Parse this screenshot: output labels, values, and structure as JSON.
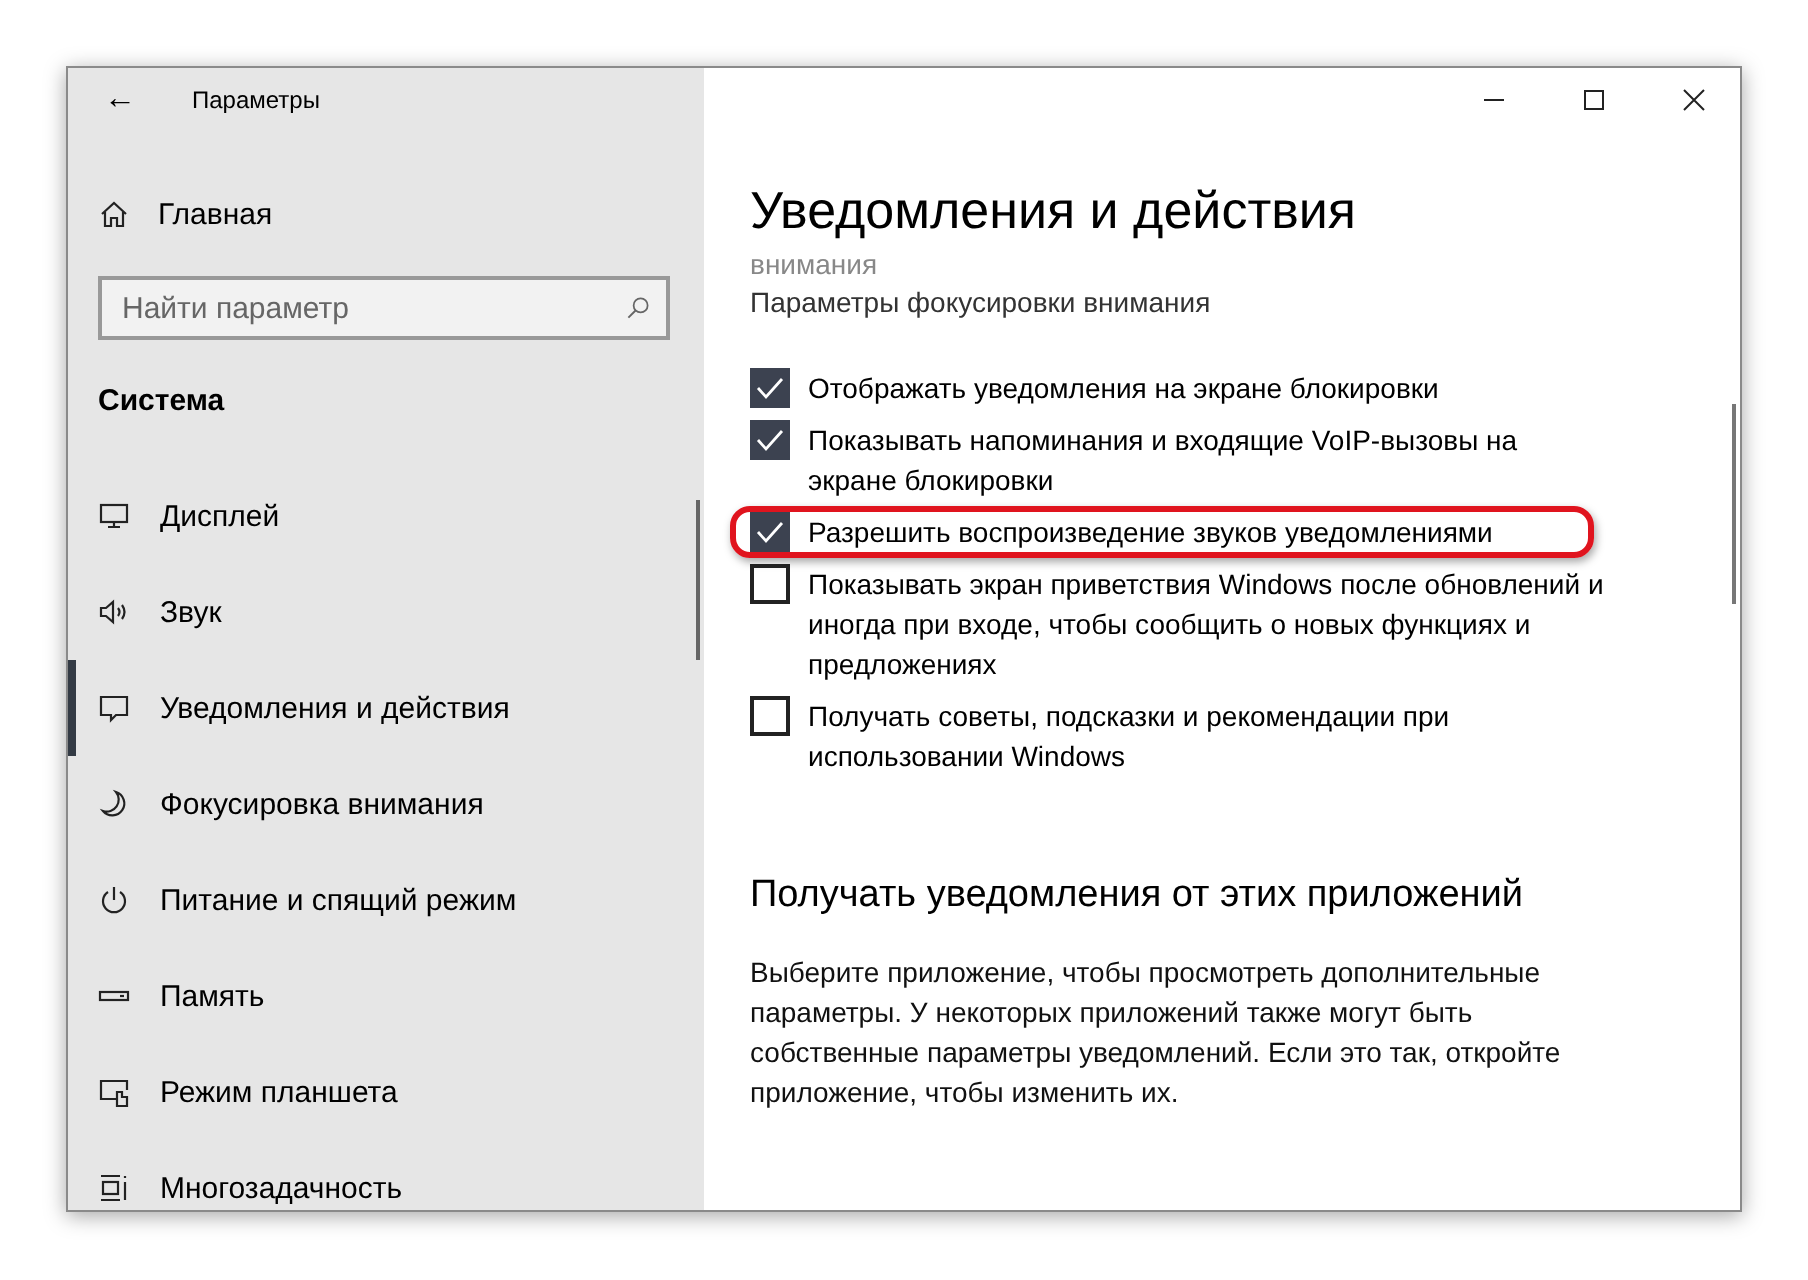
{
  "window": {
    "title": "Параметры",
    "back": "←"
  },
  "sidebar": {
    "home": "Главная",
    "search": {
      "placeholder": "Найти параметр"
    },
    "section": "Система",
    "items": [
      {
        "label": "Дисплей",
        "selected": false
      },
      {
        "label": "Звук",
        "selected": false
      },
      {
        "label": "Уведомления и действия",
        "selected": true
      },
      {
        "label": "Фокусировка внимания",
        "selected": false
      },
      {
        "label": "Питание и спящий режим",
        "selected": false
      },
      {
        "label": "Память",
        "selected": false
      },
      {
        "label": "Режим планшета",
        "selected": false
      },
      {
        "label": "Многозадачность",
        "selected": false
      }
    ]
  },
  "main": {
    "title": "Уведомления и действия",
    "cut_text": "внимания",
    "link": "Параметры фокусировки внимания",
    "options": [
      {
        "label": "Отображать уведомления на экране блокировки",
        "checked": true,
        "highlighted": false
      },
      {
        "label": "Показывать напоминания и входящие VoIP-вызовы на экране блокировки",
        "checked": true,
        "highlighted": false
      },
      {
        "label": "Разрешить  воспроизведение звуков уведомлениями",
        "checked": true,
        "highlighted": true
      },
      {
        "label": "Показывать экран приветствия Windows после обновлений и иногда при входе, чтобы сообщить о новых функциях и предложениях",
        "checked": false,
        "highlighted": false
      },
      {
        "label": "Получать советы, подсказки и рекомендации при использовании Windows",
        "checked": false,
        "highlighted": false
      }
    ],
    "apps_heading": "Получать уведомления от этих приложений",
    "apps_text": "Выберите приложение, чтобы просмотреть дополнительные параметры. У некоторых приложений также могут быть собственные параметры уведомлений. Если это так, откройте приложение, чтобы изменить их."
  }
}
